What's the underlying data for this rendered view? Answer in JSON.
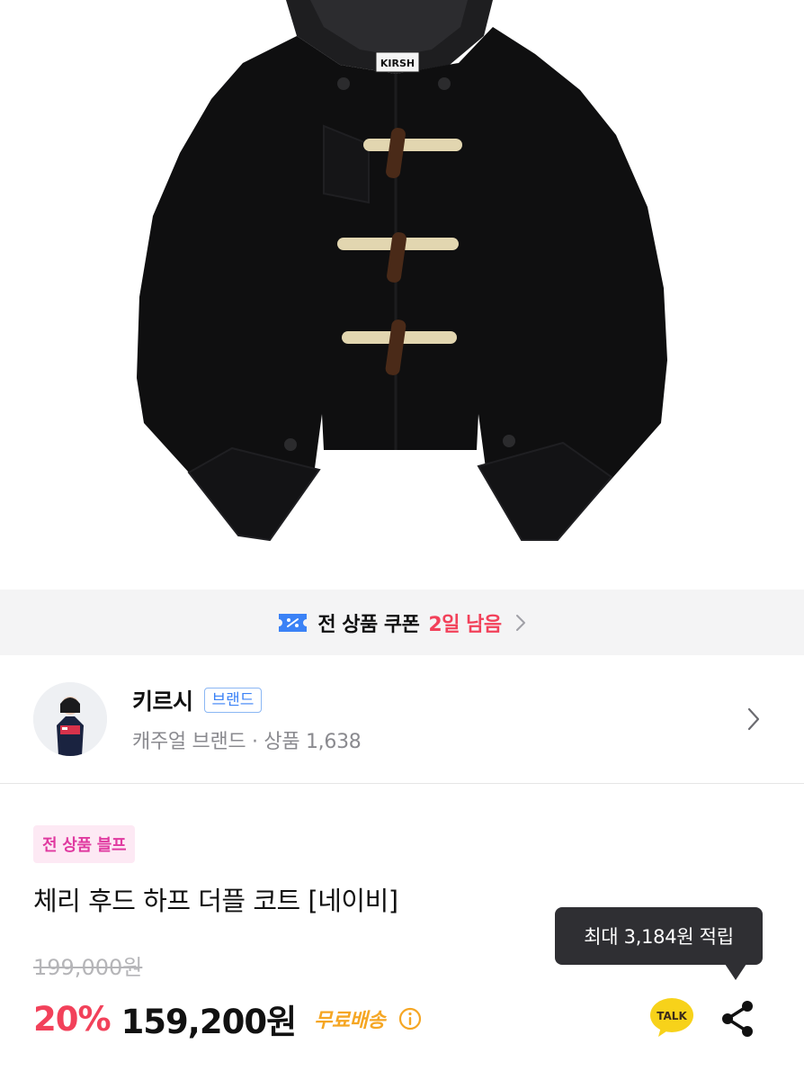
{
  "product_image": {
    "alt": "black hooded half duffle coat",
    "label_tag": "KIRSH",
    "colors": {
      "coat": "#0f0f10",
      "toggle_wood": "#4a2a18",
      "rope": "#e2d6b0"
    }
  },
  "coupon_banner": {
    "icon": "coupon-ticket-icon",
    "text": "전 상품 쿠폰",
    "days_left": "2일 남음",
    "chevron": "chevron-right-icon"
  },
  "brand": {
    "name": "키르시",
    "badge": "브랜드",
    "meta": "캐주얼 브랜드 · 상품 1,638",
    "chevron": "chevron-right-icon"
  },
  "promo_tag": "전 상품 블프",
  "product": {
    "title": "체리 후드 하프 더플 코트 [네이비]",
    "original_price": "199,000원",
    "discount": "20%",
    "sale_price": "159,200원",
    "shipping": "무료배송",
    "shipping_info_icon": "info-icon"
  },
  "points_tooltip": "최대 3,184원 적립",
  "actions": {
    "kakao_talk_label": "TALK",
    "share_icon": "share-icon"
  },
  "colors": {
    "accent_red": "#f2415a",
    "badge_blue": "#3b82f6",
    "promo_pink": "#e03aa0",
    "shipping_orange": "#f5a623",
    "kakao_yellow": "#f7d21a"
  }
}
